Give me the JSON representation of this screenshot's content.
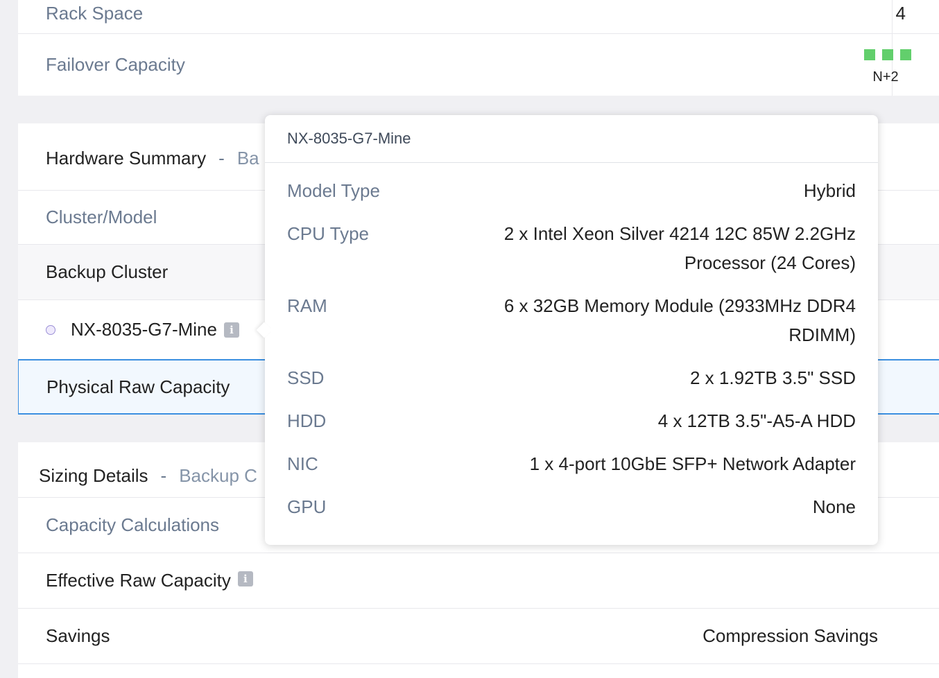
{
  "summary": {
    "rack_space_label": "Rack Space",
    "rack_space_value": "4",
    "failover_label": "Failover Capacity",
    "failover_value": "N+2",
    "failover_level": 3,
    "failover_color": "#62cf6c"
  },
  "hardware": {
    "title": "Hardware Summary",
    "separator": "-",
    "subtitle_fragment": "Ba",
    "cluster_model_label": "Cluster/Model",
    "backup_cluster_label": "Backup Cluster",
    "node_name": "NX-8035-G7-Mine",
    "info_icon": "i",
    "physical_raw_label": "Physical Raw Capacity"
  },
  "sizing": {
    "title": "Sizing Details",
    "separator": "-",
    "subtitle_fragment": "Backup C",
    "capacity_calc_label": "Capacity Calculations",
    "effective_raw_label": "Effective Raw Capacity",
    "savings_label": "Savings",
    "savings_value": "Compression Savings"
  },
  "tooltip": {
    "title": "NX-8035-G7-Mine",
    "specs": [
      {
        "key": "Model Type",
        "value": "Hybrid"
      },
      {
        "key": "CPU Type",
        "value": "2 x Intel Xeon Silver 4214 12C 85W 2.2GHz Processor (24 Cores)"
      },
      {
        "key": "RAM",
        "value": "6 x 32GB Memory Module (2933MHz DDR4 RDIMM)"
      },
      {
        "key": "SSD",
        "value": "2 x 1.92TB 3.5\" SSD"
      },
      {
        "key": "HDD",
        "value": "4 x 12TB 3.5\"-A5-A HDD"
      },
      {
        "key": "NIC",
        "value": "1 x 4-port 10GbE SFP+ Network Adapter"
      },
      {
        "key": "GPU",
        "value": "None"
      }
    ]
  }
}
